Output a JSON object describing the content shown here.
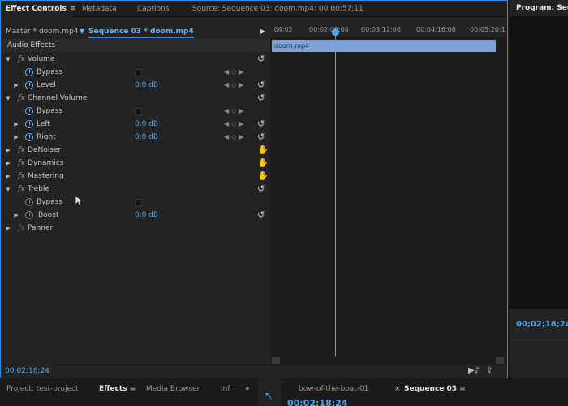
{
  "tabs": {
    "effect_controls": "Effect Controls",
    "metadata": "Metadata",
    "captions": "Captions",
    "source": "Source: Sequence 03: doom.mp4: 00;00;57;11",
    "program": "Program: Seque"
  },
  "header": {
    "master": "Master * doom.mp4",
    "sequence": "Sequence 03 * doom.mp4"
  },
  "ruler": {
    "ticks": [
      ";04;02",
      "00;02;08;04",
      "00;03;12;06",
      "00;04;16;08",
      "00;05;20;1"
    ]
  },
  "clip": {
    "name": "doom.mp4"
  },
  "effects": {
    "section": "Audio Effects",
    "volume": "Volume",
    "bypass": "Bypass",
    "level": "Level",
    "level_val": "0.0 dB",
    "channel_volume": "Channel Volume",
    "bypass2": "Bypass",
    "left": "Left",
    "left_val": "0.0 dB",
    "right": "Right",
    "right_val": "0.0 dB",
    "denoiser": "DeNoiser",
    "dynamics": "Dynamics",
    "mastering": "Mastering",
    "treble": "Treble",
    "bypass3": "Bypass",
    "boost": "Boost",
    "boost_val": "0.0 dB",
    "panner": "Panner"
  },
  "footer": {
    "timecode": "00;02;18;24"
  },
  "program": {
    "timecode": "00;02;18;24"
  },
  "bottom": {
    "project": "Project: test-project",
    "effects": "Effects",
    "media_browser": "Media Browser",
    "info": "Inf",
    "timeline_tab1": "bow-of-the-boat-01",
    "timeline_tab2": "Sequence 03",
    "timeline_time": "00;02;18;24"
  },
  "colors": {
    "accent": "#2d8ceb",
    "value_blue": "#4fa6f0",
    "clip": "#7fa3d8"
  }
}
